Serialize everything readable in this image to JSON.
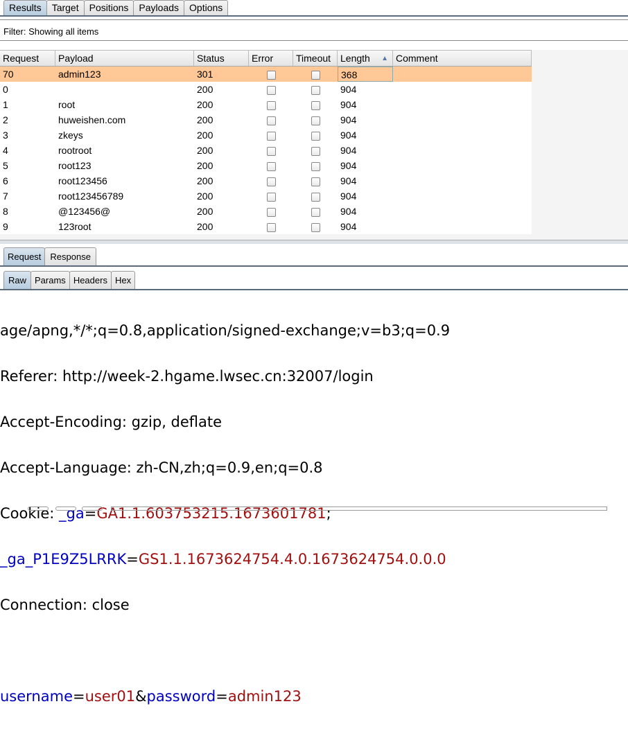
{
  "top_tabs": [
    "Results",
    "Target",
    "Positions",
    "Payloads",
    "Options"
  ],
  "filter": "Filter: Showing all items",
  "columns": [
    "Request",
    "Payload",
    "Status",
    "Error",
    "Timeout",
    "Length",
    "Comment"
  ],
  "sort_icon": "triangle-up-icon",
  "rows": [
    [
      "70",
      "admin123",
      "301",
      "368"
    ],
    [
      "0",
      "",
      "200",
      "904"
    ],
    [
      "1",
      "root",
      "200",
      "904"
    ],
    [
      "2",
      "huweishen.com",
      "200",
      "904"
    ],
    [
      "3",
      "zkeys",
      "200",
      "904"
    ],
    [
      "4",
      "rootroot",
      "200",
      "904"
    ],
    [
      "5",
      "root123",
      "200",
      "904"
    ],
    [
      "6",
      "root123456",
      "200",
      "904"
    ],
    [
      "7",
      "root123456789",
      "200",
      "904"
    ],
    [
      "8",
      "@123456@",
      "200",
      "904"
    ],
    [
      "9",
      "123root",
      "200",
      "904"
    ]
  ],
  "selected_color": "#ffc896",
  "msg_tabs": [
    "Request",
    "Response"
  ],
  "view_tabs": [
    "Raw",
    "Params",
    "Headers",
    "Hex"
  ],
  "raw": {
    "l1": "age/apng,*/*;q=0.8,application/signed-exchange;v=b3;q=0.9",
    "l2": "Referer: http://week-2.hgame.lwsec.cn:32007/login",
    "l3": "Accept-Encoding: gzip, deflate",
    "l4": "Accept-Language: zh-CN,zh;q=0.9,en;q=0.8",
    "cookie_label": "Cookie: ",
    "c1k": "_ga",
    "c1v": "GA1.1.603753215.1673601781",
    "c1s": ";",
    "c2k": "_ga_P1E9Z5LRRK",
    "c2v": "GS1.1.1673624754.4.0.1673624754.0.0.0",
    "l7": "Connection: close",
    "p1k": "username",
    "p1v": "user01",
    "amp": "&",
    "p2k": "password",
    "p2v": "admin123",
    "eq": "="
  }
}
